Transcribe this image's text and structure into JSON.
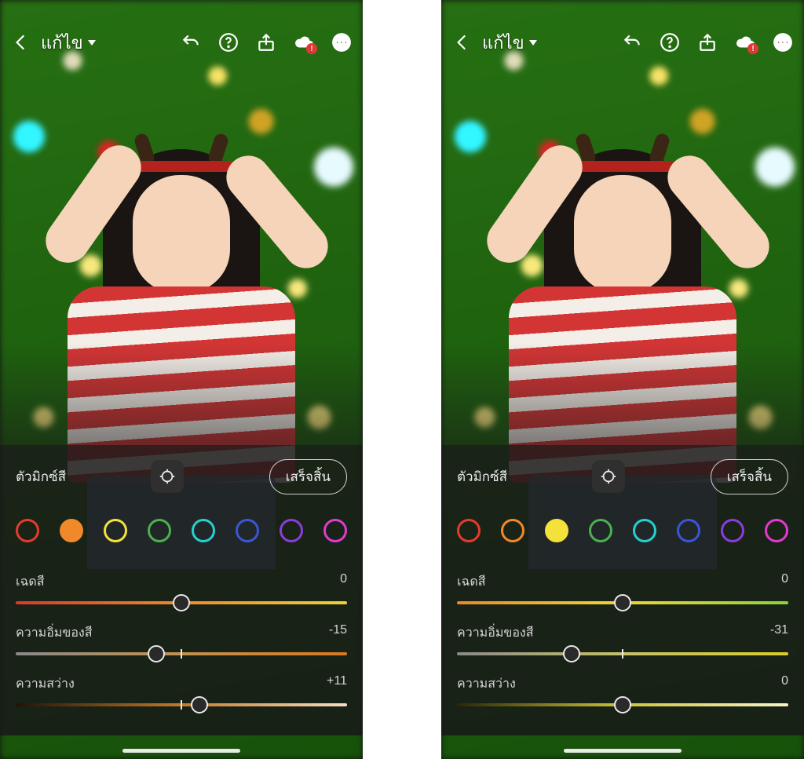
{
  "screens": [
    {
      "header": {
        "title": "แก้ไข"
      },
      "panel": {
        "title": "ตัวมิกซ์สี",
        "done_label": "เสร็จสิ้น",
        "swatches": [
          {
            "color": "#e43b2f",
            "selected": false
          },
          {
            "color": "#f0892a",
            "selected": true
          },
          {
            "color": "#f4e23a",
            "selected": false
          },
          {
            "color": "#4caf50",
            "selected": false
          },
          {
            "color": "#27d0cf",
            "selected": false
          },
          {
            "color": "#3a56d6",
            "selected": false
          },
          {
            "color": "#8b3ddb",
            "selected": false
          },
          {
            "color": "#e23ad0",
            "selected": false
          }
        ],
        "sliders": [
          {
            "label": "เฉดสี",
            "value": "0",
            "pos": 50,
            "gradient": "linear-gradient(90deg,#d63a2d,#f08a2b,#e9d23a)"
          },
          {
            "label": "ความอิ่มของสี",
            "value": "-15",
            "pos": 42.5,
            "gradient": "linear-gradient(90deg,#8a8a8a,#c29150,#d9791f)"
          },
          {
            "label": "ความสว่าง",
            "value": "+11",
            "pos": 55.5,
            "gradient": "linear-gradient(90deg,#201307,#c27a2a,#f5dfc1)"
          }
        ]
      }
    },
    {
      "header": {
        "title": "แก้ไข"
      },
      "panel": {
        "title": "ตัวมิกซ์สี",
        "done_label": "เสร็จสิ้น",
        "swatches": [
          {
            "color": "#e43b2f",
            "selected": false
          },
          {
            "color": "#f0892a",
            "selected": false
          },
          {
            "color": "#f4e23a",
            "selected": true
          },
          {
            "color": "#4caf50",
            "selected": false
          },
          {
            "color": "#27d0cf",
            "selected": false
          },
          {
            "color": "#3a56d6",
            "selected": false
          },
          {
            "color": "#8b3ddb",
            "selected": false
          },
          {
            "color": "#e23ad0",
            "selected": false
          }
        ],
        "sliders": [
          {
            "label": "เฉดสี",
            "value": "0",
            "pos": 50,
            "gradient": "linear-gradient(90deg,#e78b2a,#eed63a,#8bd23a)"
          },
          {
            "label": "ความอิ่มของสี",
            "value": "-31",
            "pos": 34.5,
            "gradient": "linear-gradient(90deg,#8a8a8a,#c6c268,#d9cd2a)"
          },
          {
            "label": "ความสว่าง",
            "value": "0",
            "pos": 50,
            "gradient": "linear-gradient(90deg,#2a2608,#cfc43a,#f7f3c9)"
          }
        ]
      }
    }
  ]
}
